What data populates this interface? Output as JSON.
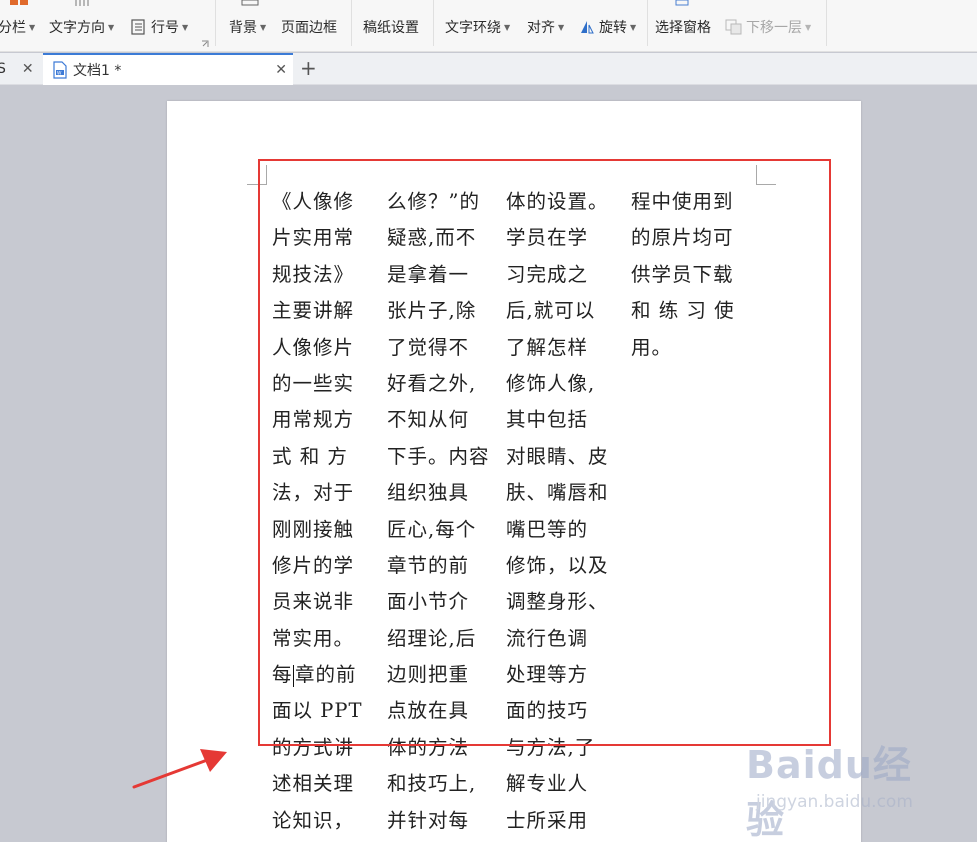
{
  "ribbon": {
    "columns_label": "分栏",
    "text_direction_label": "文字方向",
    "line_numbers_label": "行号",
    "background_label": "背景",
    "page_border_label": "页面边框",
    "manuscript_settings_label": "稿纸设置",
    "text_wrap_label": "文字环绕",
    "align_label": "对齐",
    "rotate_label": "旋转",
    "selection_pane_label": "选择窗格",
    "send_backward_label": "下移一层"
  },
  "tabs": {
    "prev_tab_fragment": "S",
    "active_tab_label": "文档1 *",
    "new_tab_symbol": "+"
  },
  "document": {
    "columns": [
      [
        "《人像修",
        "片实用常",
        "规技法》",
        "主要讲解",
        "人像修片",
        "的一些实",
        "用常规方",
        "式 和 方",
        "法，对于",
        "刚刚接触",
        "修片的学",
        "员来说非",
        "常实用。",
        "每章的前",
        "面以 PPT",
        "的方式讲",
        "述相关理",
        "论知识，"
      ],
      [
        "么修？”的",
        "疑惑,而不",
        "是拿着一",
        "张片子,除",
        "了觉得不",
        "好看之外,",
        "不知从何",
        "下手。内容",
        "组织独具",
        "匠心,每个",
        "章节的前",
        "面小节介",
        "绍理论,后",
        "边则把重",
        "点放在具",
        "体的方法",
        "和技巧上,",
        "并针对每"
      ],
      [
        "体的设置。",
        "学员在学",
        "习完成之",
        "后,就可以",
        "了解怎样",
        "修饰人像,",
        "其中包括",
        "对眼睛、皮",
        "肤、嘴唇和",
        "嘴巴等的",
        "修饰，以及",
        "调整身形、",
        "流行色调",
        "处理等方",
        "面的技巧",
        "与方法,了",
        "解专业人",
        "士所采用"
      ],
      [
        "程中使用到",
        "的原片均可",
        "供学员下载",
        "和 练 习 使",
        "用。"
      ]
    ]
  },
  "watermark": {
    "brand": "Baidu经验",
    "url": "jingyan.baidu.com"
  },
  "colors": {
    "highlight_box": "#e53935",
    "arrow": "#e53935",
    "active_tab_accent": "#3c7bd6"
  }
}
